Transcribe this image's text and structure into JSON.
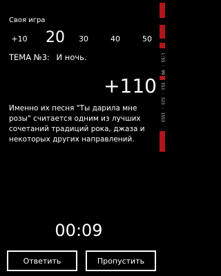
{
  "header": {
    "title": "Своя игра"
  },
  "points": [
    "+10",
    "20",
    "30",
    "40",
    "50"
  ],
  "theme": {
    "label": "ТЕМА №3:",
    "name": "И ночь."
  },
  "question": {
    "value": "+110",
    "text": "Именно их песня \"Ты дарила мне розы\" считается одним из лучших сочетаний традиций рока, джаза и некоторых других направлений."
  },
  "timer": "00:09",
  "buttons": {
    "answer": "Ответить",
    "skip": "Пропустить"
  },
  "system_strip": {
    "text": "1:55 · 99 · 553 · 523 · 1553"
  },
  "colors": {
    "background": "#000000",
    "foreground": "#ffffff",
    "system_accent": "#b0151b"
  }
}
